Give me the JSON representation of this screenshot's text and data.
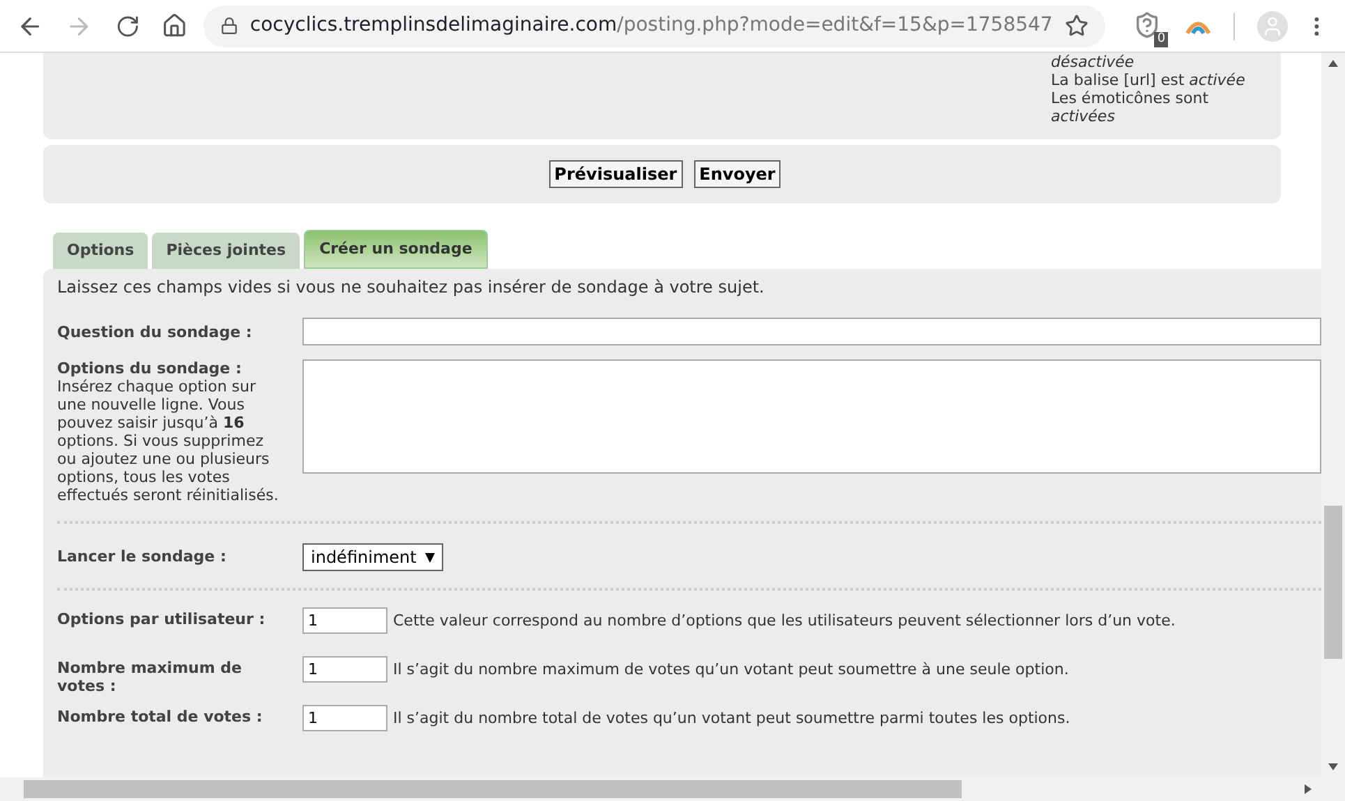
{
  "browser": {
    "url_host": "cocyclics.tremplinsdelimaginaire.com",
    "url_path": "/posting.php?mode=edit&f=15&p=1758547",
    "badge": "0"
  },
  "bbcode_status": [
    "*désactivée*",
    "La balise [url] est *activée*",
    "Les émoticônes sont *activées*"
  ],
  "buttons": [
    "Prévisualiser",
    "Envoyer"
  ],
  "tabs": [
    {
      "label": "Options",
      "selected": false
    },
    {
      "label": "Pièces jointes",
      "selected": false
    },
    {
      "label": "Créer un sondage",
      "selected": true
    }
  ],
  "poll": {
    "intro": "Laissez ces champs vides si vous ne souhaitez pas insérer de sondage à votre sujet.",
    "question_label": "Question du sondage :",
    "options_label": "Options du sondage :",
    "options_help": "Insérez chaque option sur une nouvelle ligne. Vous pouvez saisir jusqu’à **16** options. Si vous supprimez ou ajoutez une ou plusieurs options, tous les votes effectués seront réinitialisés.",
    "duration_label": "Lancer le sondage :",
    "duration_value": "indéfiniment",
    "settings": [
      {
        "label": "Options par utilisateur :",
        "value": "1",
        "help": "Cette valeur correspond au nombre d’options que les utilisateurs peuvent sélectionner lors d’un vote."
      },
      {
        "label": "Nombre maximum de votes :",
        "value": "1",
        "help": "Il s’agit du nombre maximum de votes qu’un votant peut soumettre à une seule option."
      },
      {
        "label": "Nombre total de votes :",
        "value": "1",
        "help": "Il s’agit du nombre total de votes qu’un votant peut soumettre parmi toutes les options."
      }
    ]
  }
}
